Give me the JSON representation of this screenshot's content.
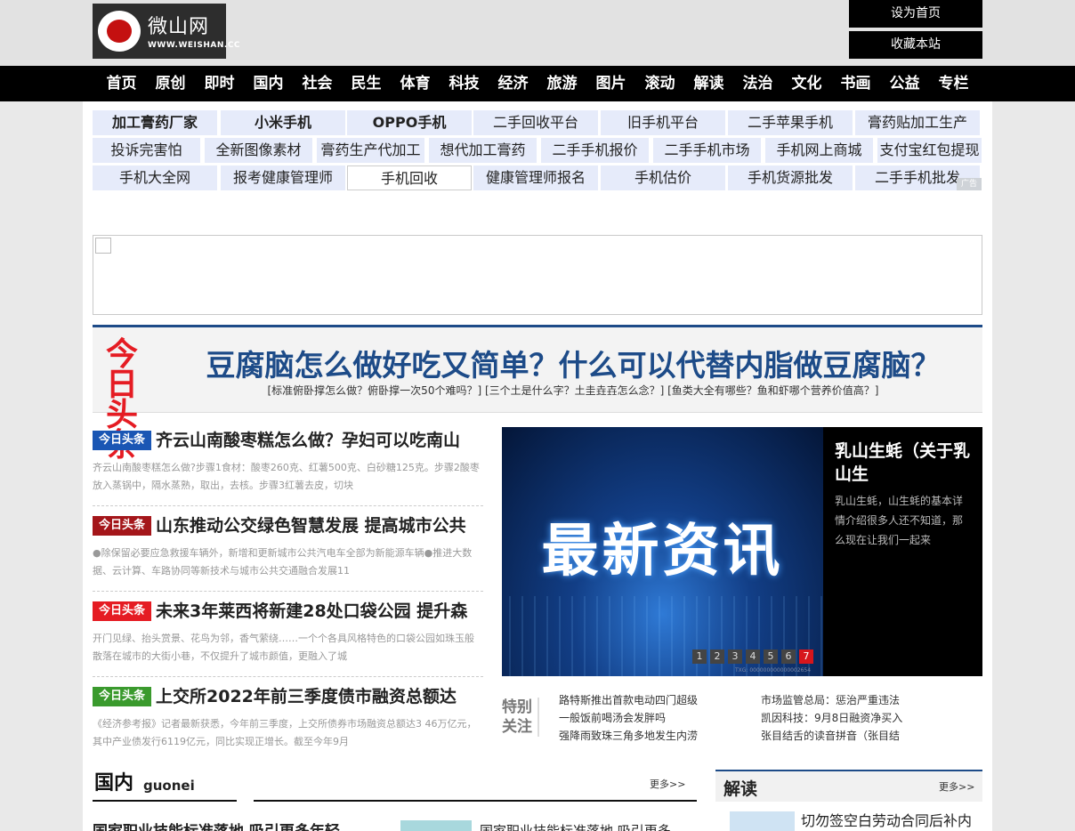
{
  "site": {
    "logo_name": "微山网",
    "logo_url": "WWW.WEISHAN.CC",
    "set_home_label": "设为首页",
    "bookmark_label": "收藏本站"
  },
  "nav": {
    "items": [
      "首页",
      "原创",
      "即时",
      "国内",
      "社会",
      "民生",
      "体育",
      "科技",
      "经济",
      "旅游",
      "图片",
      "滚动",
      "解读",
      "法治",
      "文化",
      "书画",
      "公益",
      "专栏"
    ]
  },
  "keyword_ads": {
    "rows": [
      [
        "加工膏药厂家",
        "小米手机",
        "OPPO手机",
        "二手回收平台",
        "旧手机平台",
        "二手苹果手机",
        "膏药贴加工生产"
      ],
      [
        "投诉完害怕",
        "全新图像素材",
        "膏药生产代加工",
        "想代加工膏药",
        "二手手机报价",
        "二手手机市场",
        "手机网上商城",
        "支付宝红包提现"
      ],
      [
        "手机大全网",
        "报考健康管理师",
        "手机回收",
        "健康管理师报名",
        "手机估价",
        "手机货源批发",
        "二手手机批发"
      ]
    ],
    "ad_tag": "广告"
  },
  "headline": {
    "logo_top": "今日",
    "logo_bottom": "头条",
    "title": "豆腐脑怎么做好吃又简单？什么可以代替内脂做豆腐脑？",
    "sub_links": "[标准俯卧撑怎么做？俯卧撑一次50个难吗？] [三个土是什么字？土圭垚壵怎么念？] [鱼类大全有哪些？鱼和虾哪个营养价值高？]"
  },
  "news": [
    {
      "tag": "今日头条",
      "tag_color": "#1a56b4",
      "title": "齐云山南酸枣糕怎么做？孕妇可以吃南山",
      "desc": "齐云山南酸枣糕怎么做?步骤1食材：酸枣260克、红薯500克、白砂糖125克。步骤2酸枣放入蒸锅中，隔水蒸熟，取出，去核。步骤3红薯去皮，切块"
    },
    {
      "tag": "今日头条",
      "tag_color": "#a4161a",
      "title": "山东推动公交绿色智慧发展 提高城市公共",
      "desc": "●除保留必要应急救援车辆外，新增和更新城市公共汽电车全部为新能源车辆●推进大数据、云计算、车路协同等新技术与城市公共交通融合发展11"
    },
    {
      "tag": "今日头条",
      "tag_color": "#e51c23",
      "title": "未来3年莱西将新建28处口袋公园 提升森",
      "desc": "开门见绿、抬头赏景、花鸟为邻，香气萦绕……一个个各具风格特色的口袋公园如珠玉般散落在城市的大街小巷，不仅提升了城市颜值，更融入了城"
    },
    {
      "tag": "今日头条",
      "tag_color": "#3a9a2d",
      "title": "上交所2022年前三季度债市融资总额达",
      "desc": "《经济参考报》记者最新获悉，今年前三季度，上交所债券市场融资总额达3 46万亿元，其中产业债发行6119亿元，同比实现正增长。截至今年9月"
    }
  ],
  "slider": {
    "image_text": "最新资讯",
    "caption": "乳山生蚝（关于乳山生",
    "desc": "乳山生蚝，山生蚝的基本详情介绍很多人还不知道，那么现在让我们一起来",
    "dots": [
      "1",
      "2",
      "3",
      "4",
      "5",
      "6",
      "7"
    ],
    "active_dot": "7",
    "credit": "TXG: 000000000000002654"
  },
  "focus": {
    "label": "特别关注",
    "left_items": [
      "路特斯推出首款电动四门超级",
      "一般饭前喝汤会发胖吗",
      "强降雨致珠三角多地发生内涝"
    ],
    "right_items": [
      "市场监管总局：惩治严重违法",
      "凯因科技：9月8日融资净买入",
      "张目结舌的读音拼音（张目结"
    ]
  },
  "section_guonei": {
    "title": "国内",
    "subtitle": "guonei",
    "more": "更多>>",
    "cut_left": "国家职业技能标准落地 吸引更多年轻",
    "cut_mid": "国家职业技能标准落地 吸引更多"
  },
  "section_jiedu": {
    "title": "解读",
    "more": "更多>>",
    "first_item": "切勿签空白劳动合同后补内"
  }
}
